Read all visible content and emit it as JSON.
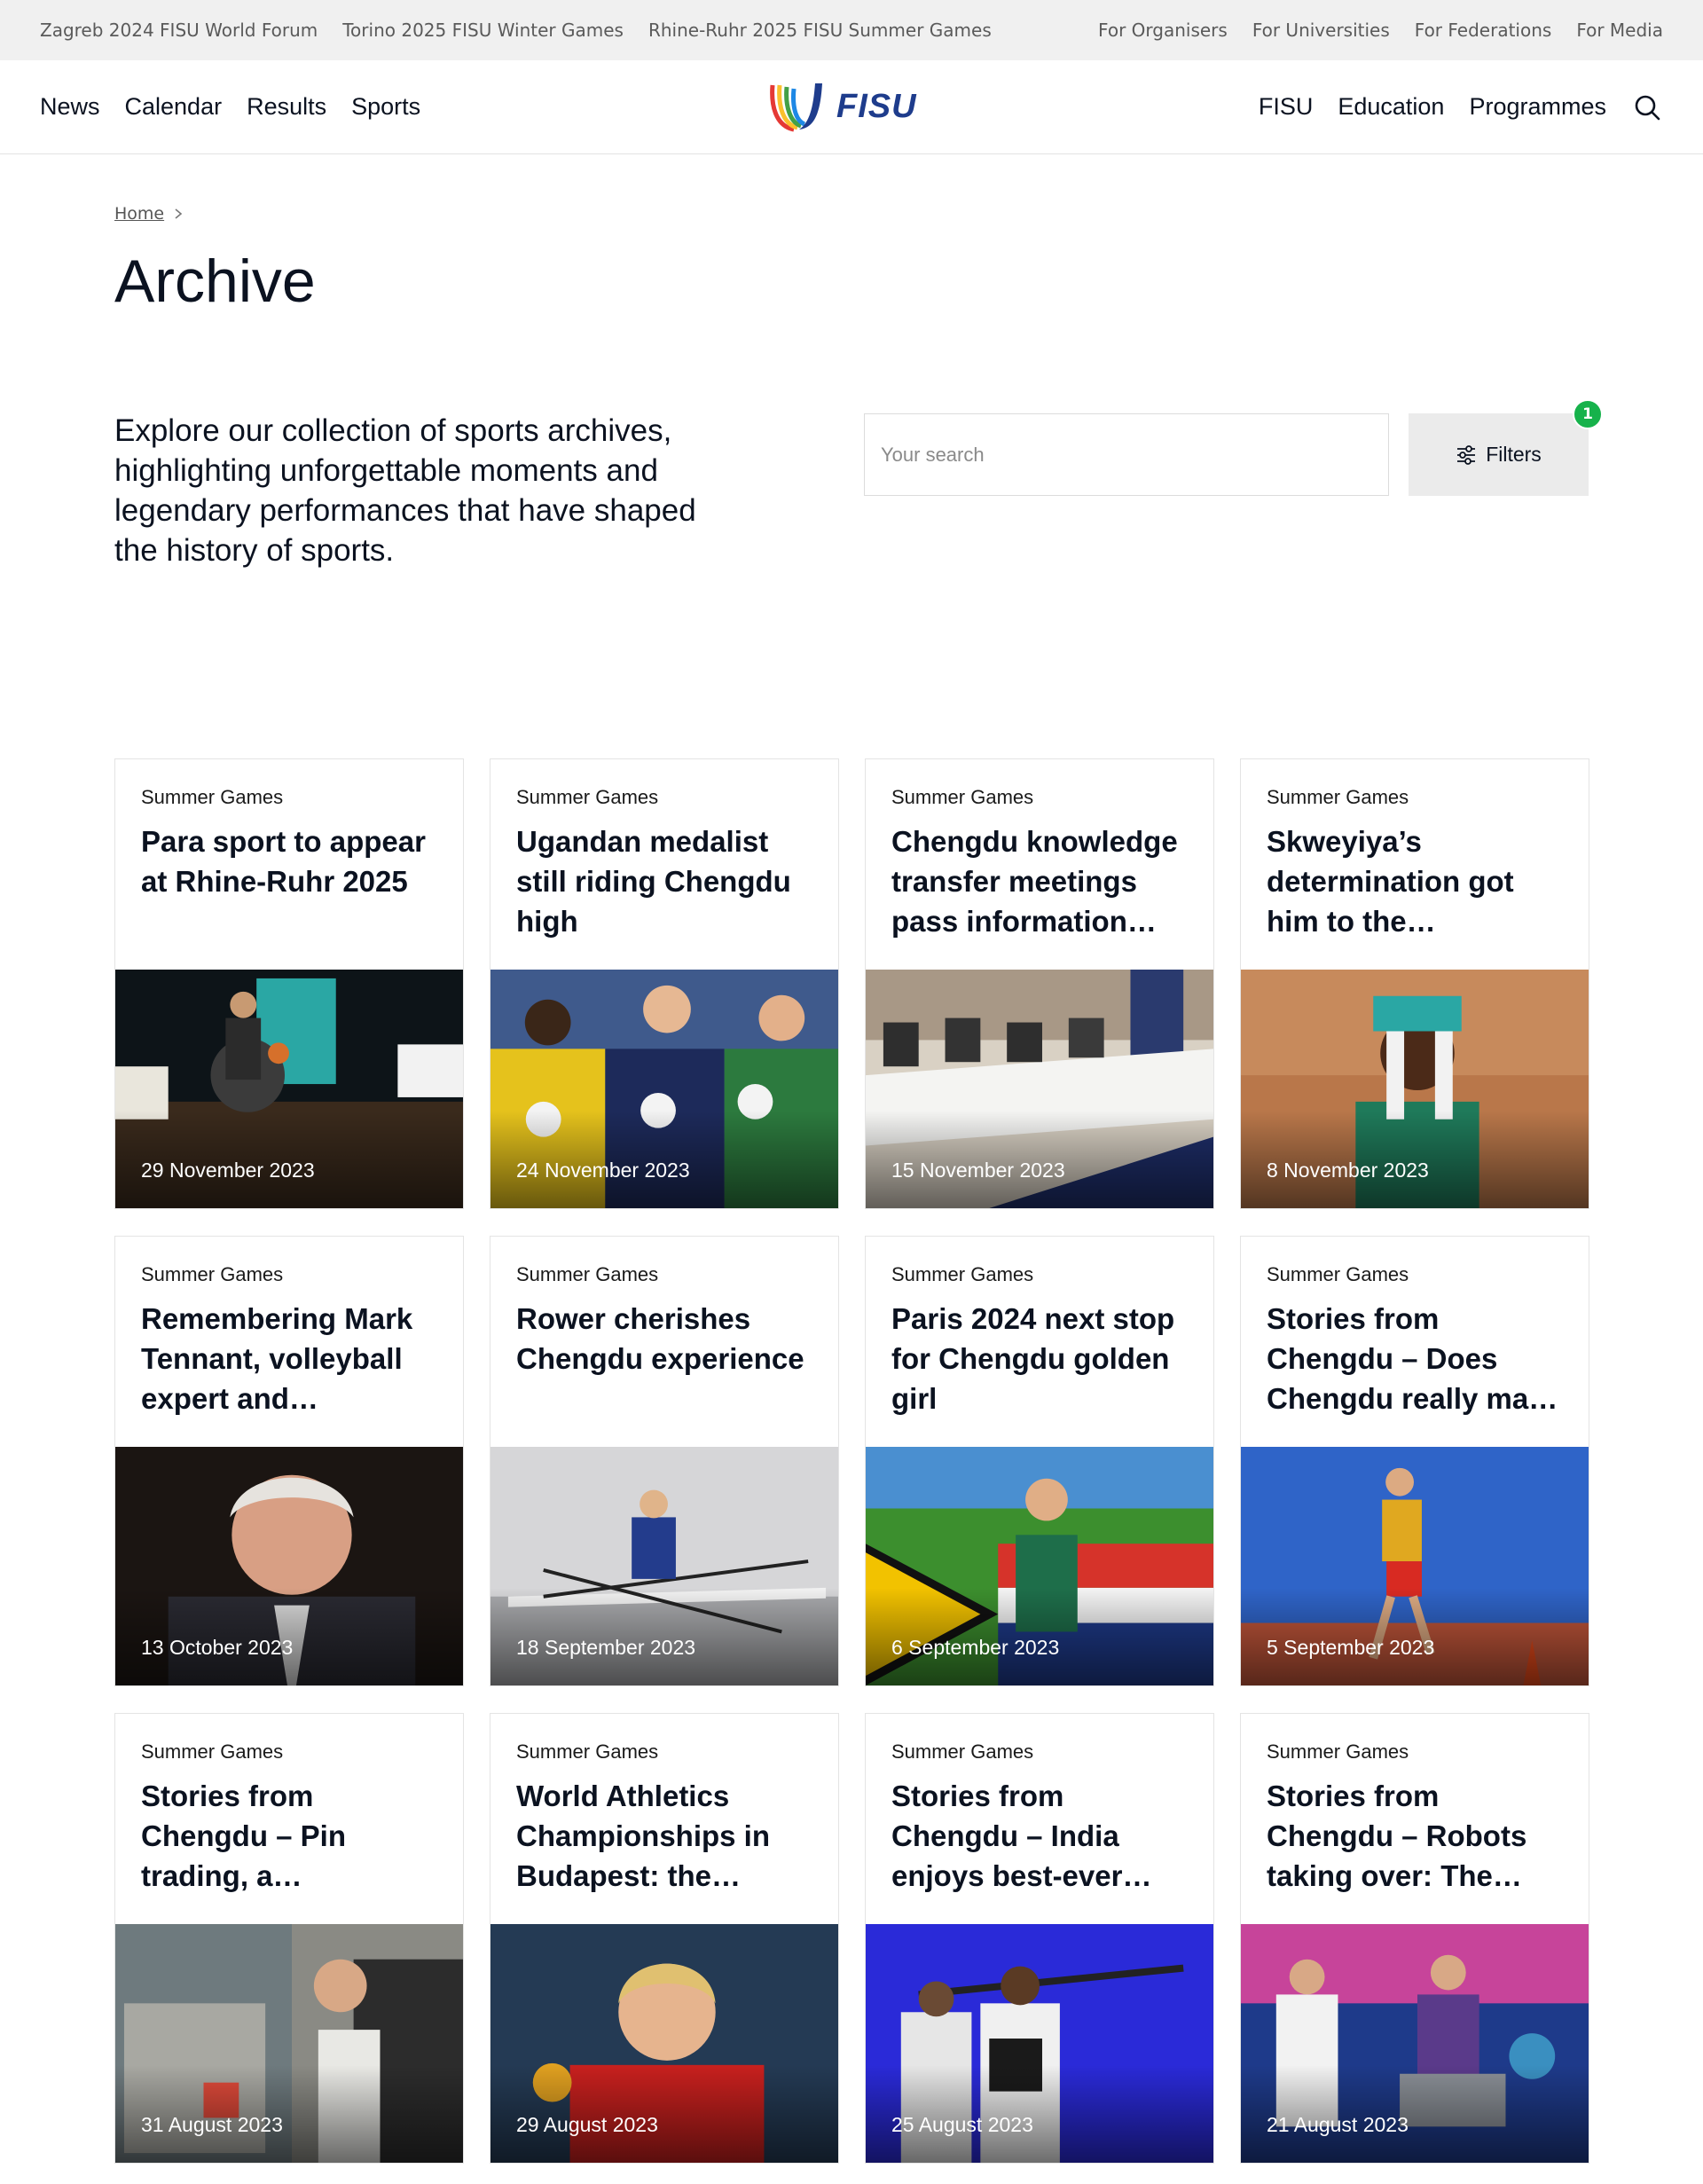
{
  "topbar": {
    "left_links": [
      "Zagreb 2024 FISU World Forum",
      "Torino 2025 FISU Winter Games",
      "Rhine-Ruhr 2025 FISU Summer Games"
    ],
    "right_links": [
      "For Organisers",
      "For Universities",
      "For Federations",
      "For Media"
    ]
  },
  "nav": {
    "left": [
      "News",
      "Calendar",
      "Results",
      "Sports"
    ],
    "logo_text": "FISU",
    "right": [
      "FISU",
      "Education",
      "Programmes"
    ],
    "search_icon": "search-icon"
  },
  "breadcrumb": {
    "home": "Home",
    "separator_icon": "chevron-right-icon"
  },
  "page": {
    "title": "Archive",
    "intro": "Explore our collection of sports archives, highlighting unforgettable moments and legendary performances that have shaped the history of sports."
  },
  "search": {
    "placeholder": "Your search",
    "value": ""
  },
  "filters": {
    "label": "Filters",
    "count": "1",
    "icon": "sliders-icon",
    "badge_color": "#16b24b"
  },
  "colors": {
    "brand": "#1e3c8c",
    "text": "#0b1220"
  },
  "cards": [
    {
      "category": "Summer Games",
      "title": "Para sport to appear at Rhine-Ruhr 2025",
      "date": "29 November 2023"
    },
    {
      "category": "Summer Games",
      "title": "Ugandan medalist still riding Chengdu high",
      "date": "24 November 2023"
    },
    {
      "category": "Summer Games",
      "title": "Chengdu knowledge transfer meetings pass information to…",
      "date": "15 November 2023"
    },
    {
      "category": "Summer Games",
      "title": "Skweyiya’s determination got him to the Chengdu…",
      "date": "8 November 2023"
    },
    {
      "category": "Summer Games",
      "title": "Remembering Mark Tennant, volleyball expert and universit…",
      "date": "13 October 2023"
    },
    {
      "category": "Summer Games",
      "title": "Rower cherishes Chengdu experience",
      "date": "18 September 2023"
    },
    {
      "category": "Summer Games",
      "title": "Paris 2024 next stop for Chengdu golden girl",
      "date": "6 September 2023"
    },
    {
      "category": "Summer Games",
      "title": "Stories from Chengdu – Does Chengdu really make dreams…",
      "date": "5 September 2023"
    },
    {
      "category": "Summer Games",
      "title": "Stories from Chengdu – Pin trading, a competition unto…",
      "date": "31 August 2023"
    },
    {
      "category": "Summer Games",
      "title": "World Athletics Championships in Budapest: the…",
      "date": "29 August 2023"
    },
    {
      "category": "Summer Games",
      "title": "Stories from Chengdu – India enjoys best-ever FISU Games…",
      "date": "25 August 2023"
    },
    {
      "category": "Summer Games",
      "title": "Stories from Chengdu – Robots taking over: The future of table…",
      "date": "21 August 2023"
    }
  ]
}
